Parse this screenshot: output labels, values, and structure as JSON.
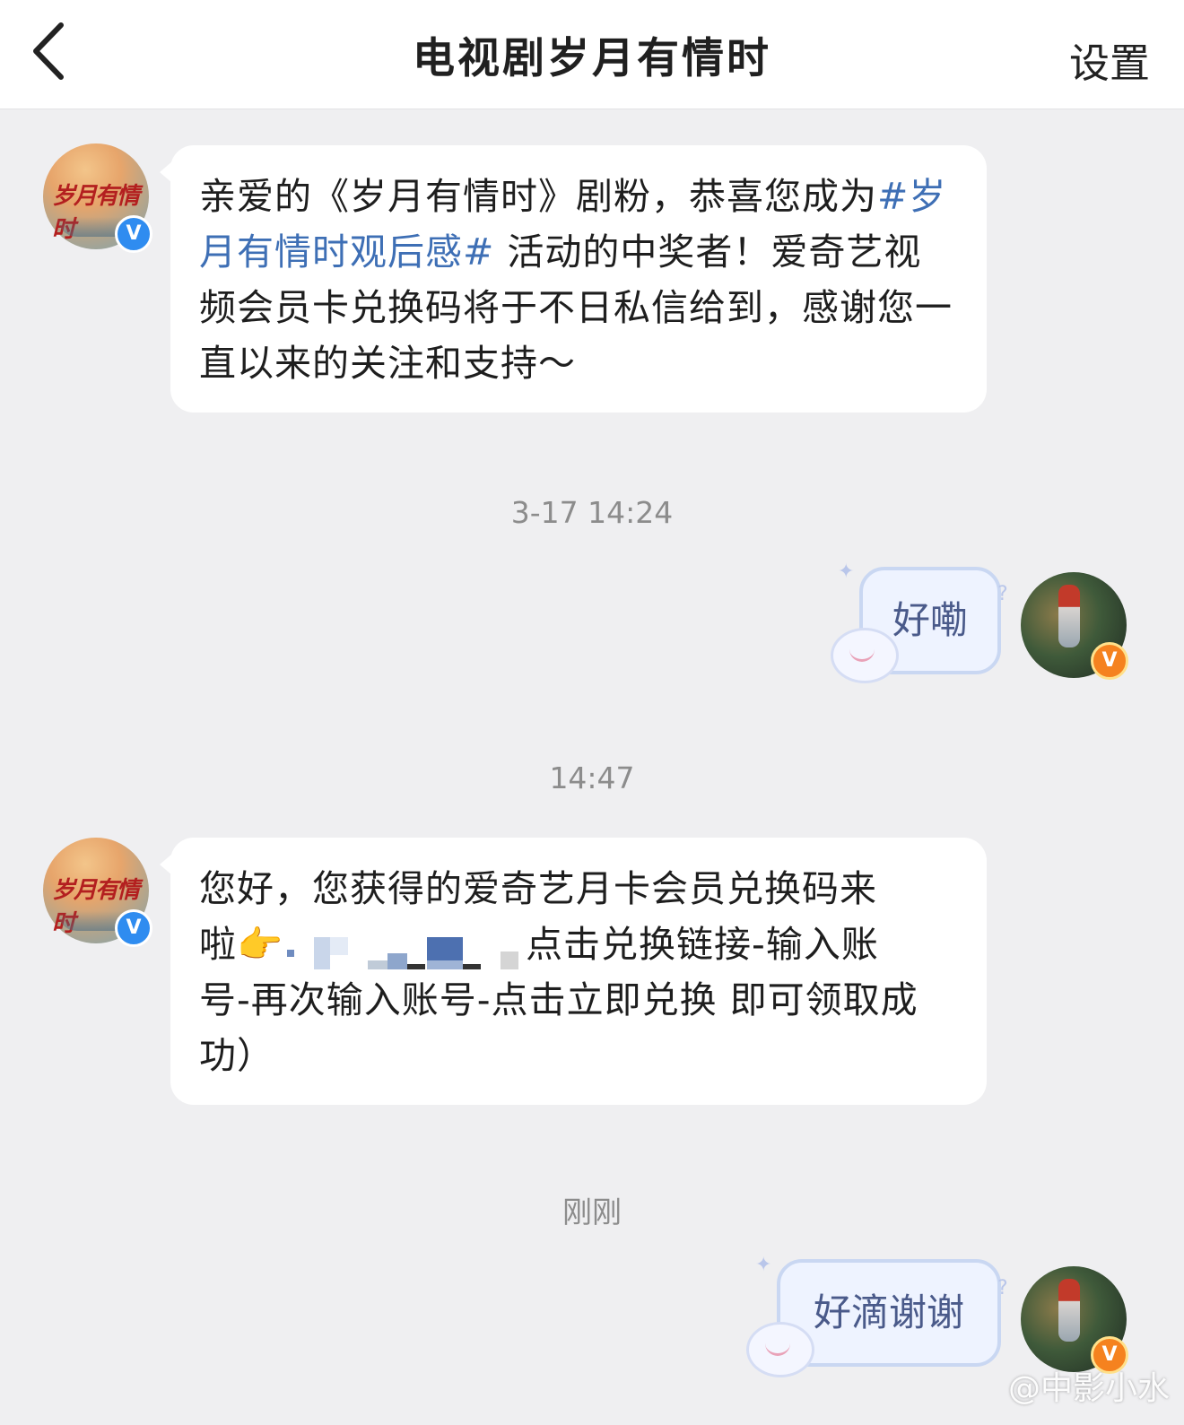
{
  "header": {
    "title": "电视剧岁月有情时",
    "settings_label": "设置"
  },
  "official_account": {
    "avatar_text": "岁月有情时",
    "badge": "V"
  },
  "user": {
    "badge": "V"
  },
  "messages": [
    {
      "direction": "in",
      "text_before": "亲爱的《岁月有情时》剧粉，恭喜您成为",
      "hashtag": "#岁月有情时观后感#",
      "text_after": " 活动的中奖者！爱奇艺视频会员卡兑换码将于不日私信给到，感谢您一直以来的关注和支持～"
    },
    {
      "type": "timestamp",
      "text": "3-17 14:24"
    },
    {
      "direction": "out",
      "text": "好嘞"
    },
    {
      "type": "timestamp",
      "text": "14:47"
    },
    {
      "direction": "in",
      "text_line1": "您好，您获得的爱奇艺月卡会员兑换码来",
      "text_line2_prefix": "啦👉",
      "text_line2_suffix": "点击兑换链接-输入账",
      "text_rest": "号-再次输入账号-点击立即兑换 即可领取成功）"
    },
    {
      "type": "timestamp",
      "text": "刚刚"
    },
    {
      "direction": "out",
      "text": "好滴谢谢"
    }
  ],
  "watermark": "@中影小水",
  "colors": {
    "hashtag": "#3e6fb5",
    "background": "#efeff1",
    "verified_blue": "#2f8cf0",
    "vip_orange": "#f5821f"
  }
}
